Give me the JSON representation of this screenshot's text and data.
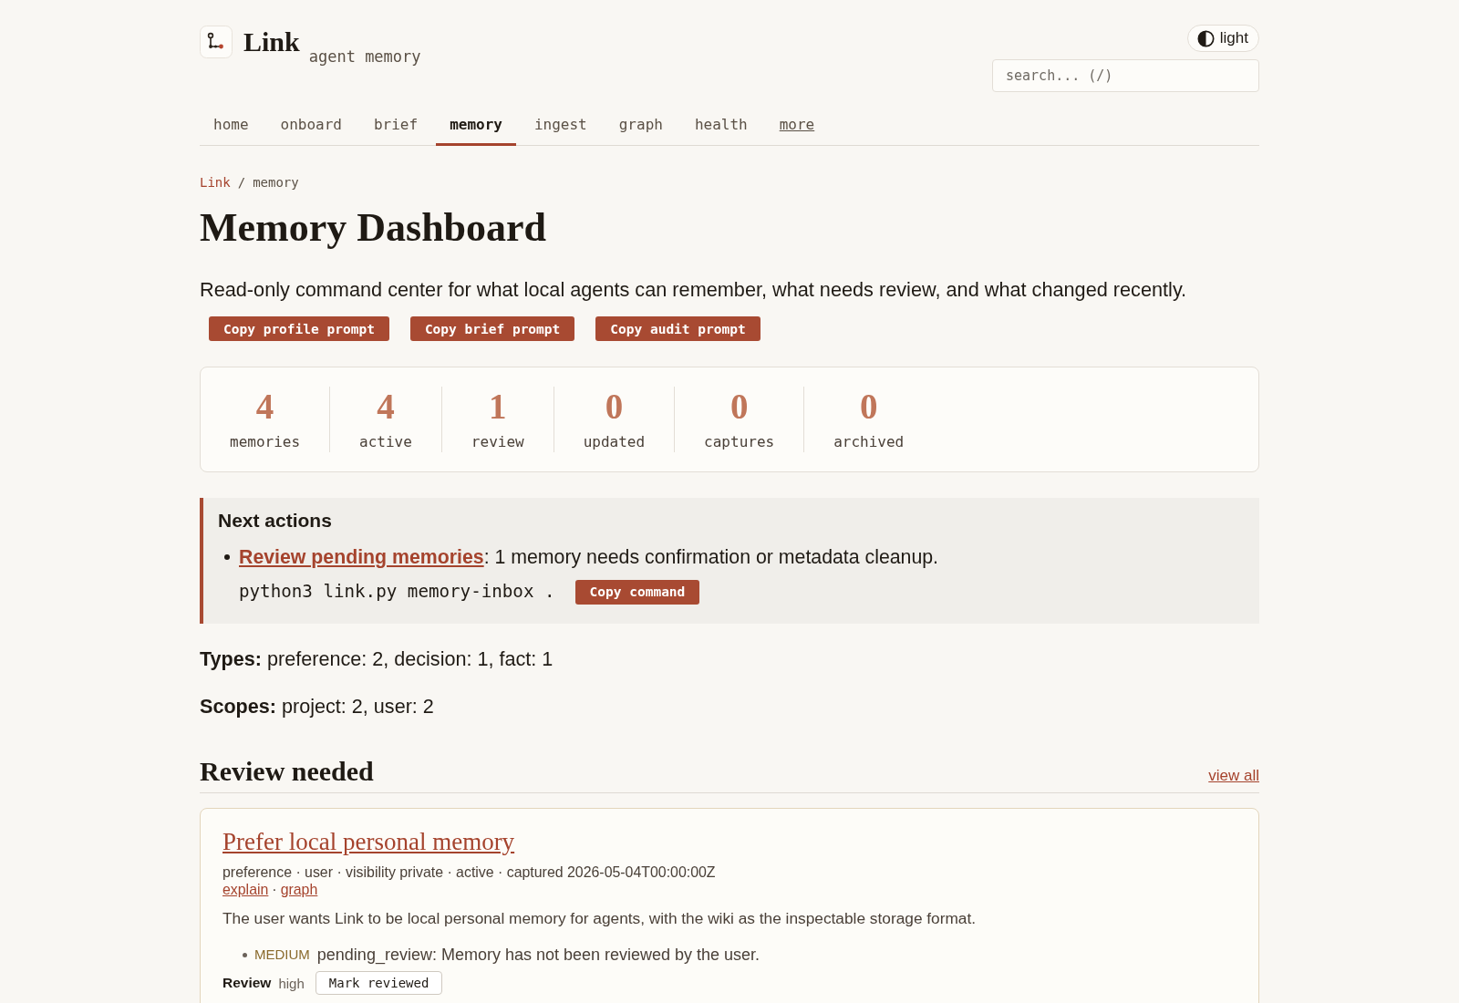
{
  "header": {
    "site_name": "Link",
    "tagline": "agent memory",
    "theme_toggle": "light",
    "search": {
      "placeholder": "search... (/)"
    }
  },
  "nav": [
    {
      "label": "home",
      "kind": "tab",
      "selected": false
    },
    {
      "label": "onboard",
      "kind": "tab",
      "selected": false
    },
    {
      "label": "brief",
      "kind": "tab",
      "selected": false
    },
    {
      "label": "memory",
      "kind": "tab",
      "selected": true
    },
    {
      "label": "ingest",
      "kind": "tab",
      "selected": false
    },
    {
      "label": "graph",
      "kind": "tab",
      "selected": false
    },
    {
      "label": "health",
      "kind": "tab",
      "selected": false
    },
    {
      "label": "more",
      "kind": "link",
      "selected": false
    }
  ],
  "breadcrumb": {
    "items": [
      {
        "label": "Link",
        "kind": "link"
      },
      {
        "label": "memory",
        "kind": "current"
      }
    ],
    "separator": "/"
  },
  "page": {
    "title": "Memory Dashboard",
    "description": "Read-only command center for what local agents can remember, what needs review, and what changed recently.",
    "actions": [
      "Copy profile prompt",
      "Copy brief prompt",
      "Copy audit prompt"
    ]
  },
  "stats": [
    {
      "value": "4",
      "label": "memories"
    },
    {
      "value": "4",
      "label": "active"
    },
    {
      "value": "1",
      "label": "review"
    },
    {
      "value": "0",
      "label": "updated"
    },
    {
      "value": "0",
      "label": "captures"
    },
    {
      "value": "0",
      "label": "archived"
    }
  ],
  "next_actions": {
    "title": "Next actions",
    "items": [
      {
        "link": "Review pending memories",
        "text": ": 1 memory needs confirmation or metadata cleanup.",
        "command": "python3 link.py memory-inbox .",
        "button": "Copy command"
      }
    ]
  },
  "summary": [
    "**Types:** preference: 2, decision: 1, fact: 1",
    "**Scopes:** project: 2, user: 2"
  ],
  "review": {
    "title": "Review needed",
    "view_all": "view all",
    "cards": [
      {
        "title": "Prefer local personal memory",
        "meta": "preference · user · visibility private · active · captured 2026-05-04T00:00:00Z",
        "links": [
          "explain",
          "graph"
        ],
        "link_separator": "·",
        "body": "The user wants Link to be local personal memory for agents, with the wiki as the inspectable storage format.",
        "issues": [
          {
            "severity": "MEDIUM",
            "color": "#8a6a2c",
            "text": "pending_review: Memory has not been reviewed by the user."
          }
        ],
        "review_label": "Review",
        "review_value": "high",
        "action": "Mark reviewed"
      }
    ]
  }
}
